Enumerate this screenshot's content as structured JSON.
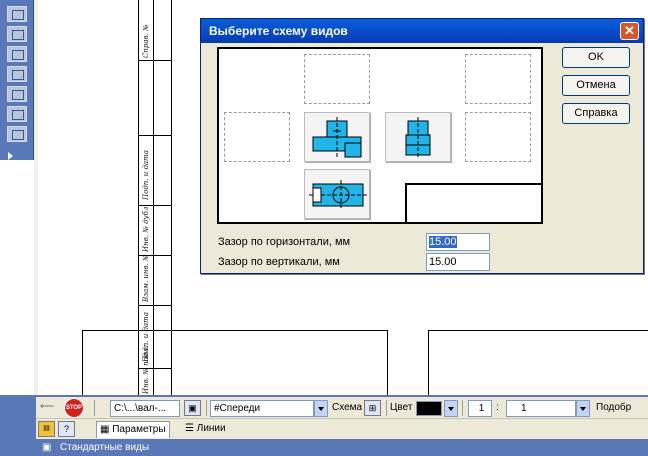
{
  "dialog": {
    "title": "Выберите схему видов",
    "ok_label": "OK",
    "cancel_label": "Отмена",
    "help_label": "Справка",
    "horizontal_gap_label": "Зазор по горизонтали, мм",
    "horizontal_gap_value": "15.00",
    "vertical_gap_label": "Зазор по вертикали, мм",
    "vertical_gap_value": "15.00"
  },
  "drawing": {
    "stamp_texts": [
      "Справ. №",
      "Подп. и дата",
      "Инв. № дубл.",
      "Взам. инв. №",
      "Подп. и дата",
      "Инв. № подл."
    ]
  },
  "toolbar": {
    "path_value": "C:\\...\\вал-...",
    "view_select_value": "#Спереди",
    "scheme_label": "Схема",
    "color_label": "Цвет",
    "scale_left": "1",
    "scale_sep": ":",
    "scale_right": "1",
    "next_label": "Подобр",
    "tab_params": "Параметры",
    "tab_lines": "Линии",
    "bottom_title": "Стандартные виды",
    "stop_label": "STOP"
  },
  "colors": {
    "titlebar": "#0a5fd8",
    "toolbar_bg": "#5a78b8",
    "view_fill": "#22b4e6",
    "selection": "#316ac5"
  }
}
